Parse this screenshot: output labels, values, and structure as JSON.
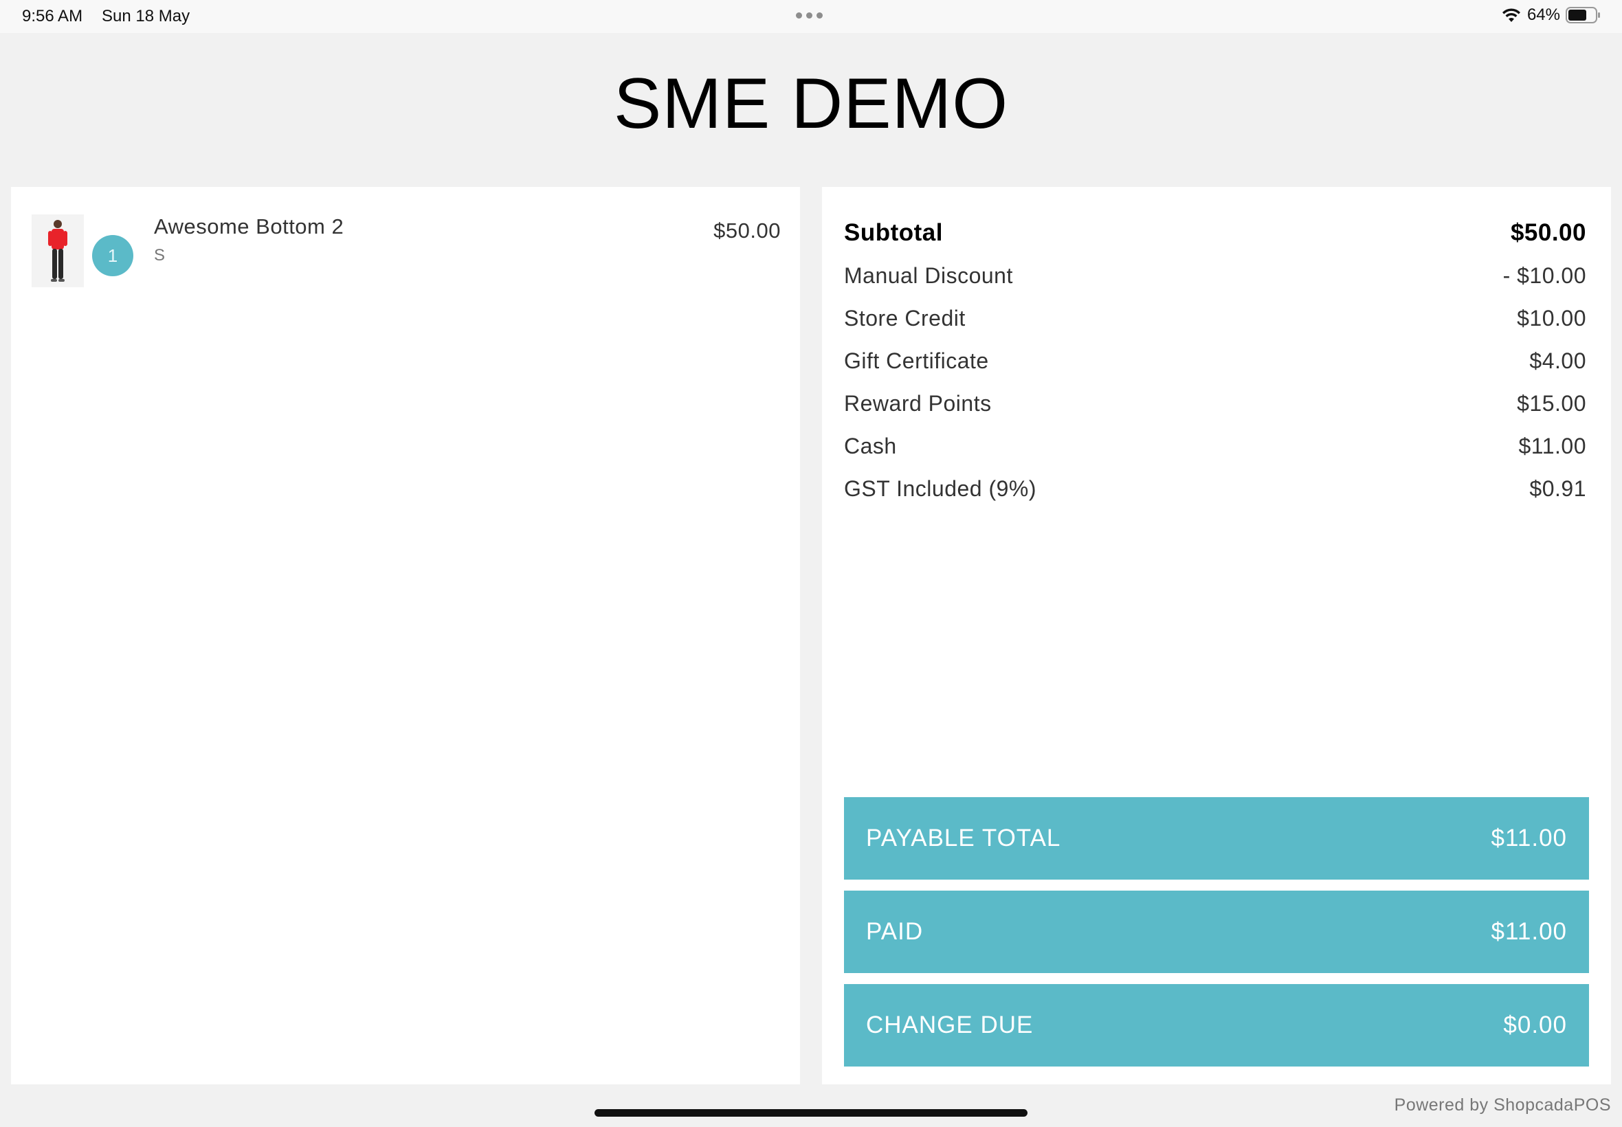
{
  "status_bar": {
    "time": "9:56 AM",
    "date": "Sun 18 May",
    "battery": "64%"
  },
  "store": {
    "title": "SME DEMO"
  },
  "cart": {
    "items": [
      {
        "name": "Awesome Bottom 2",
        "variant": "S",
        "quantity": "1",
        "price": "$50.00"
      }
    ]
  },
  "summary": {
    "rows": [
      {
        "label": "Subtotal",
        "value": "$50.00"
      },
      {
        "label": "Manual Discount",
        "value": "- $10.00"
      },
      {
        "label": "Store Credit",
        "value": "$10.00"
      },
      {
        "label": "Gift Certificate",
        "value": "$4.00"
      },
      {
        "label": "Reward Points",
        "value": "$15.00"
      },
      {
        "label": "Cash",
        "value": "$11.00"
      },
      {
        "label": "GST Included (9%)",
        "value": "$0.91"
      }
    ],
    "payable_total": {
      "label": "PAYABLE TOTAL",
      "value": "$11.00"
    },
    "paid": {
      "label": "PAID",
      "value": "$11.00"
    },
    "change_due": {
      "label": "CHANGE DUE",
      "value": "$0.00"
    }
  },
  "footer": {
    "powered_by": "Powered by ShopcadaPOS"
  },
  "colors": {
    "accent": "#5bbac8",
    "background": "#f1f1f1",
    "panel": "#ffffff"
  },
  "icons": [
    "wifi-icon",
    "battery-icon",
    "more-dots-icon"
  ]
}
